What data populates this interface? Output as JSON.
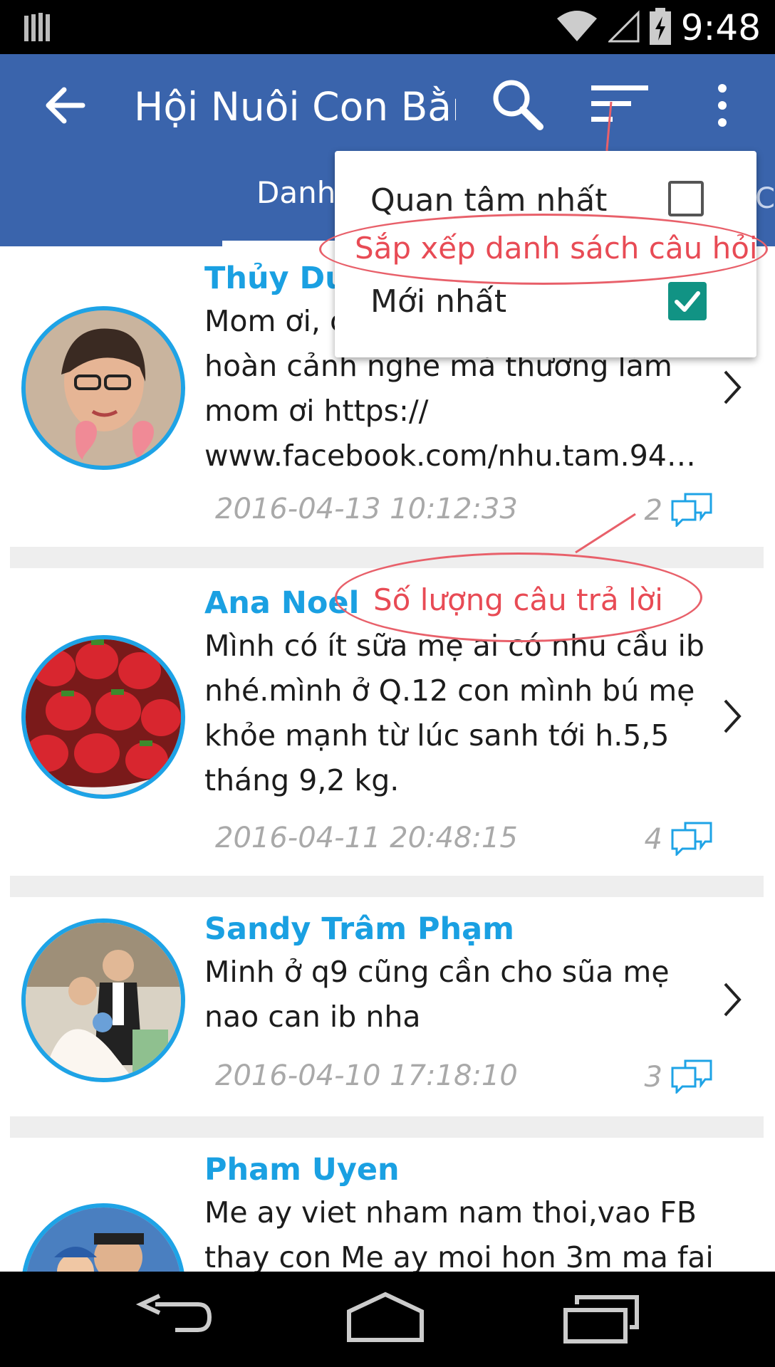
{
  "status_bar": {
    "time": "9:48"
  },
  "app_bar": {
    "title": "Hội Nuôi Con Bằng Sữa Mẹ",
    "active_tab": "Danh sách",
    "next_tab": "C"
  },
  "sort_menu": {
    "options": [
      {
        "label": "Quan tâm nhất",
        "checked": false
      },
      {
        "label": "Mới nhất",
        "checked": true
      }
    ]
  },
  "annotations": {
    "sort_note": "Sắp xếp danh sách câu hỏi",
    "count_note": "Số lượng câu trả lời",
    "color": "#e8606a"
  },
  "posts": [
    {
      "author": "Thủy Dương",
      "message": "Mom ơi, có ai biết chị này không hoàn cảnh nghe mà thương lắm mom ơi https:// www.facebook.com/nhu.tam.94…",
      "datetime": "2016-04-13 10:12:33",
      "answers": "2"
    },
    {
      "author": "Ana Noel",
      "message": "Mình có ít sữa mẹ ai có nhu cầu ib nhé.mình ở Q.12 con mình bú mẹ khỏe mạnh từ lúc sanh tới h.5,5 tháng 9,2 kg.",
      "datetime": "2016-04-11 20:48:15",
      "answers": "4"
    },
    {
      "author": "Sandy Trâm Phạm",
      "message": "Minh ở q9 cũng cần cho sũa mẹ nao can ib nha",
      "datetime": "2016-04-10 17:18:10",
      "answers": "3"
    },
    {
      "author": "Pham Uyen",
      "message": "Me ay viet nham nam thoi,vao FB thay con Me ay moi hon 3m ma fai",
      "datetime": "",
      "answers": ""
    }
  ],
  "colors": {
    "app_bar": "#3a64ac",
    "author_name": "#1aa0e2",
    "avatar_ring": "#1ea3e6",
    "checkbox_checked": "#119384"
  },
  "icons": [
    "back-arrow-icon",
    "search-icon",
    "sort-icon",
    "more-vert-icon",
    "comment-icon",
    "chevron-right-icon"
  ]
}
